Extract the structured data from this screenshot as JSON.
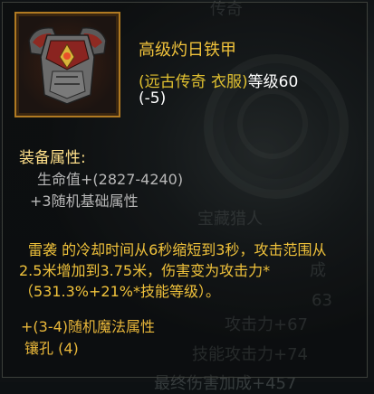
{
  "background": {
    "texts": [
      "传奇",
      "宝藏猎人",
      "成",
      "63",
      "攻击力+67",
      "技能攻击力+74",
      "最终伤害加成+457"
    ]
  },
  "tooltip": {
    "icon": "chest-armor-icon",
    "name": "高级灼日铁甲",
    "type_open": "(远古传奇 衣服)",
    "level_label": "等级",
    "level_value": "60",
    "level_delta": "(-5)",
    "section_title": "装备属性:",
    "attributes": [
      "生命值+(2827-4240)",
      "+3随机基础属性"
    ],
    "skill_name": "雷袭",
    "skill_desc": " 的冷却时间从6秒缩短到3秒，攻击范围从2.5米增加到3.75米，伤害变为攻击力*（531.3%+21%*技能等级）。",
    "magic_attrs": "+(3-4)随机魔法属性",
    "sockets": "镶孔 (4)"
  },
  "colors": {
    "name": "#f0c23b",
    "frame": "#b07a22",
    "section": "#ffe08a",
    "attribute": "#b8b8b8"
  }
}
